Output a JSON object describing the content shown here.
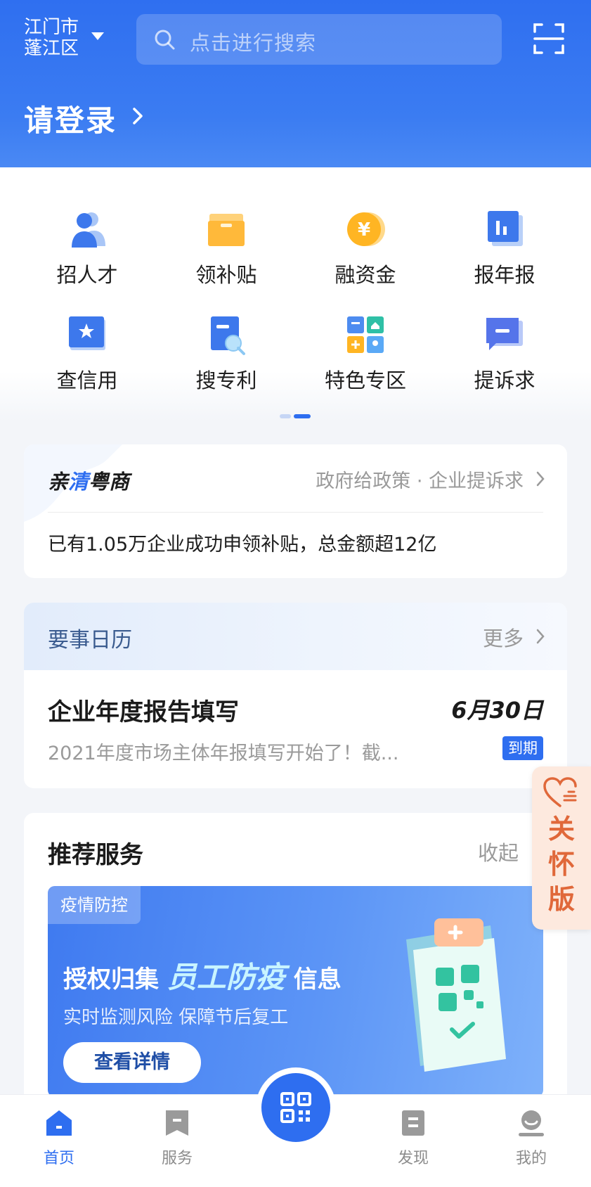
{
  "header": {
    "region_line1": "江门市",
    "region_line2": "蓬江区",
    "search_placeholder": "点击进行搜索",
    "login_label": "请登录",
    "icons": [
      "chevron-down-icon",
      "search-icon",
      "scan-icon",
      "chevron-right-icon"
    ],
    "brand_color": "#2f6ff0"
  },
  "quick_grid": {
    "items": [
      {
        "label": "招人才",
        "icon": "recruit-icon"
      },
      {
        "label": "领补贴",
        "icon": "subsidy-icon"
      },
      {
        "label": "融资金",
        "icon": "finance-icon"
      },
      {
        "label": "报年报",
        "icon": "annual-report-icon"
      },
      {
        "label": "查信用",
        "icon": "credit-icon"
      },
      {
        "label": "搜专利",
        "icon": "patent-icon"
      },
      {
        "label": "特色专区",
        "icon": "special-zone-icon"
      },
      {
        "label": "提诉求",
        "icon": "appeal-icon"
      }
    ],
    "page_index": 2,
    "page_count": 2
  },
  "qinqing": {
    "brand_part1": "亲",
    "brand_part2": "清",
    "brand_part3": "粤商",
    "subtitle": "政府给政策 · 企业提诉求",
    "message": "已有1.05万企业成功申领补贴，总金额超12亿"
  },
  "calendar": {
    "title": "要事日历",
    "more": "更多",
    "event_title": "企业年度报告填写",
    "event_date": "6月30日",
    "event_desc": "2021年度市场主体年报填写开始了！截...",
    "badge": "到期"
  },
  "recommend": {
    "title": "推荐服务",
    "collapse": "收起",
    "banner": {
      "tag": "疫情防控",
      "headline_pre": "授权归集",
      "headline_highlight": "员工防疫",
      "headline_post": "信息",
      "subtitle": "实时监测风险 保障节后复工",
      "button": "查看详情"
    }
  },
  "care_mode": {
    "chars": [
      "关",
      "怀",
      "版"
    ],
    "color": "#e0683a"
  },
  "tabbar": {
    "home": "首页",
    "service": "服务",
    "discover": "发现",
    "mine": "我的",
    "active": "首页",
    "accent": "#2e6ef0"
  }
}
